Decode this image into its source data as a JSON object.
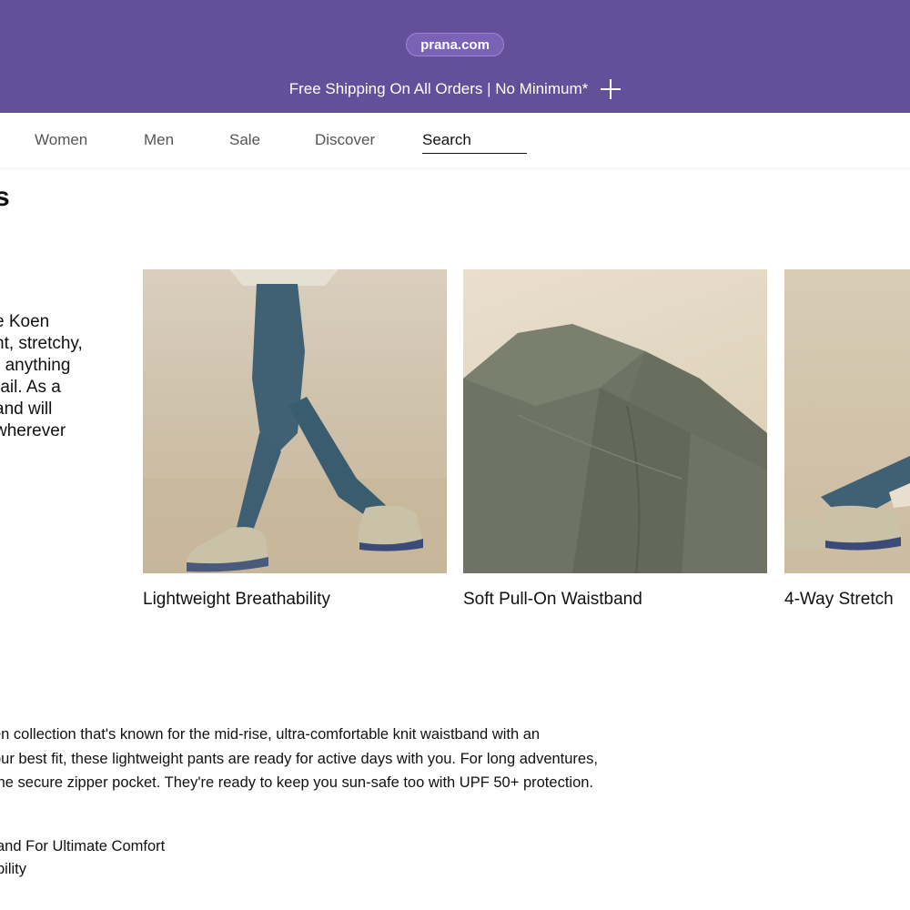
{
  "header": {
    "url": "prana.com",
    "promo_text": "Free Shipping On All Orders | No Minimum*",
    "expand_icon": "plus-icon",
    "bg_color": "#644f9a"
  },
  "nav": {
    "items": [
      {
        "label": "Women"
      },
      {
        "label": "Men"
      },
      {
        "label": "Sale"
      },
      {
        "label": "Discover"
      }
    ],
    "search_label": "Search"
  },
  "section": {
    "title_fragment": "s",
    "intro_lines": [
      "e Koen",
      "ht, stretchy,",
      "r anything",
      "rail. As a",
      "and will",
      " wherever"
    ]
  },
  "features": [
    {
      "caption": "Lightweight Breathability",
      "image": "model-walking-in-teal-pants"
    },
    {
      "caption": "Soft Pull-On Waistband",
      "image": "olive-pants-waistband-closeup"
    },
    {
      "caption": "4-Way Stretch",
      "image": "model-seated-in-teal-pants"
    }
  ],
  "description": {
    "lines": [
      "en collection that's known for the mid-rise, ultra-comfortable knit waistband with an",
      "our best fit, these lightweight pants are ready for active days with you. For long adventures,",
      " the secure zipper pocket. They're ready to keep you sun-safe too with UPF 50+ protection."
    ],
    "bullets": [
      "and For Ultimate Comfort",
      "bility"
    ]
  }
}
